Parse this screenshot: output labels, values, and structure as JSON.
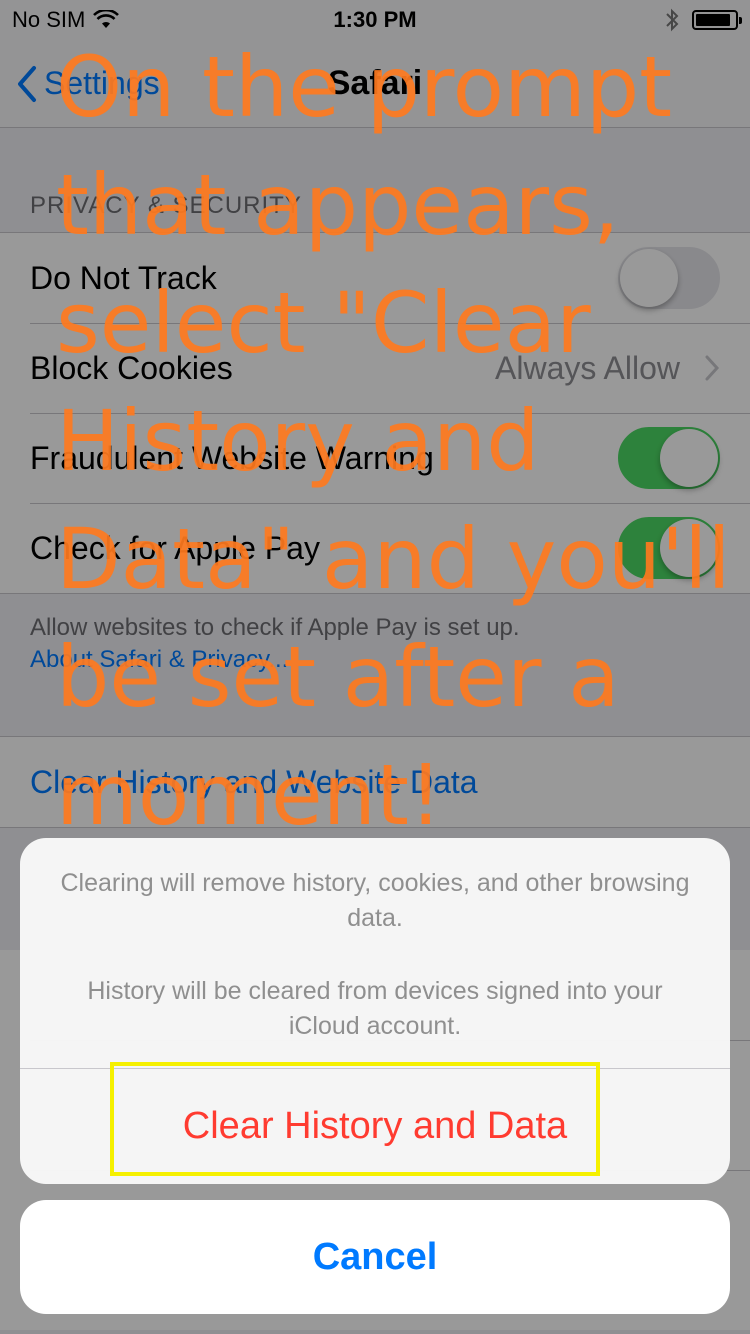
{
  "status_bar": {
    "carrier": "No SIM",
    "time": "1:30 PM",
    "battery_level": 0.9
  },
  "nav": {
    "back_label": "Settings",
    "title": "Safari"
  },
  "privacy": {
    "header": "PRIVACY & SECURITY",
    "rows": [
      {
        "label": "Do Not Track",
        "toggle": false
      },
      {
        "label": "Block Cookies",
        "value": "Always Allow"
      },
      {
        "label": "Fraudulent Website Warning",
        "toggle": true
      },
      {
        "label": "Check for Apple Pay",
        "toggle": true
      }
    ],
    "footer": "Allow websites to check if Apple Pay is set up.",
    "footer_link": "About Safari & Privacy..."
  },
  "clear_row": {
    "label": "Clear History and Website Data"
  },
  "sheet": {
    "message1": "Clearing will remove history, cookies, and other browsing data.",
    "message2": "History will be cleared from devices signed into your iCloud account.",
    "action": "Clear History and Data",
    "cancel": "Cancel"
  },
  "instruction": "On the prompt that appears, select \"Clear History and Data\" and you'll be set after a moment!",
  "colors": {
    "accent": "#007aff",
    "destructive": "#ff3b30",
    "toggle_on": "#4cd964",
    "highlight": "#f5f000",
    "overlay_text": "#ff7a1e"
  }
}
